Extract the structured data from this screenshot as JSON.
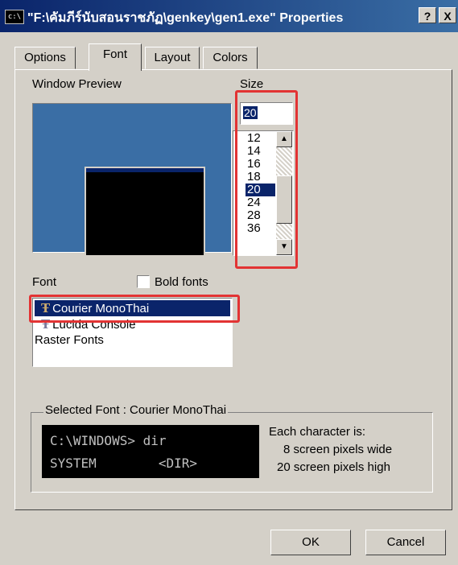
{
  "window": {
    "title": "\"F:\\คัมภีร์นับสอนราชภัฏ\\genkey\\gen1.exe\" Properties",
    "title_icon": "c:\\",
    "help_label": "?",
    "close_label": "X"
  },
  "tabs": [
    {
      "label": "Options",
      "active": false
    },
    {
      "label": "Font",
      "active": true
    },
    {
      "label": "Layout",
      "active": false
    },
    {
      "label": "Colors",
      "active": false
    }
  ],
  "preview": {
    "label": "Window Preview"
  },
  "size": {
    "label": "Size",
    "value": "20",
    "options": [
      "12",
      "14",
      "16",
      "18",
      "20",
      "24",
      "28",
      "36"
    ],
    "selected": "20"
  },
  "font": {
    "label": "Font",
    "bold_label": "Bold fonts",
    "bold_checked": false,
    "items": [
      {
        "label": "Courier MonoThai",
        "icon": "truetype-icon",
        "selected": true
      },
      {
        "label": "Lucida Console",
        "icon": "truetype-icon",
        "selected": false
      },
      {
        "label": "Raster Fonts",
        "icon": "",
        "selected": false
      }
    ]
  },
  "selected_font": {
    "label": "Selected Font : Courier MonoThai",
    "sample_line1": "C:\\WINDOWS> dir",
    "sample_line2": "SYSTEM        <DIR>",
    "desc_title": "Each character is:",
    "desc_width": "8 screen pixels wide",
    "desc_height": "20 screen pixels high"
  },
  "buttons": {
    "ok": "OK",
    "cancel": "Cancel"
  },
  "colors": {
    "highlight": "#e23333",
    "titlebar": "#0a246a",
    "selection": "#0a246a",
    "desktop": "#3a6ea5"
  }
}
